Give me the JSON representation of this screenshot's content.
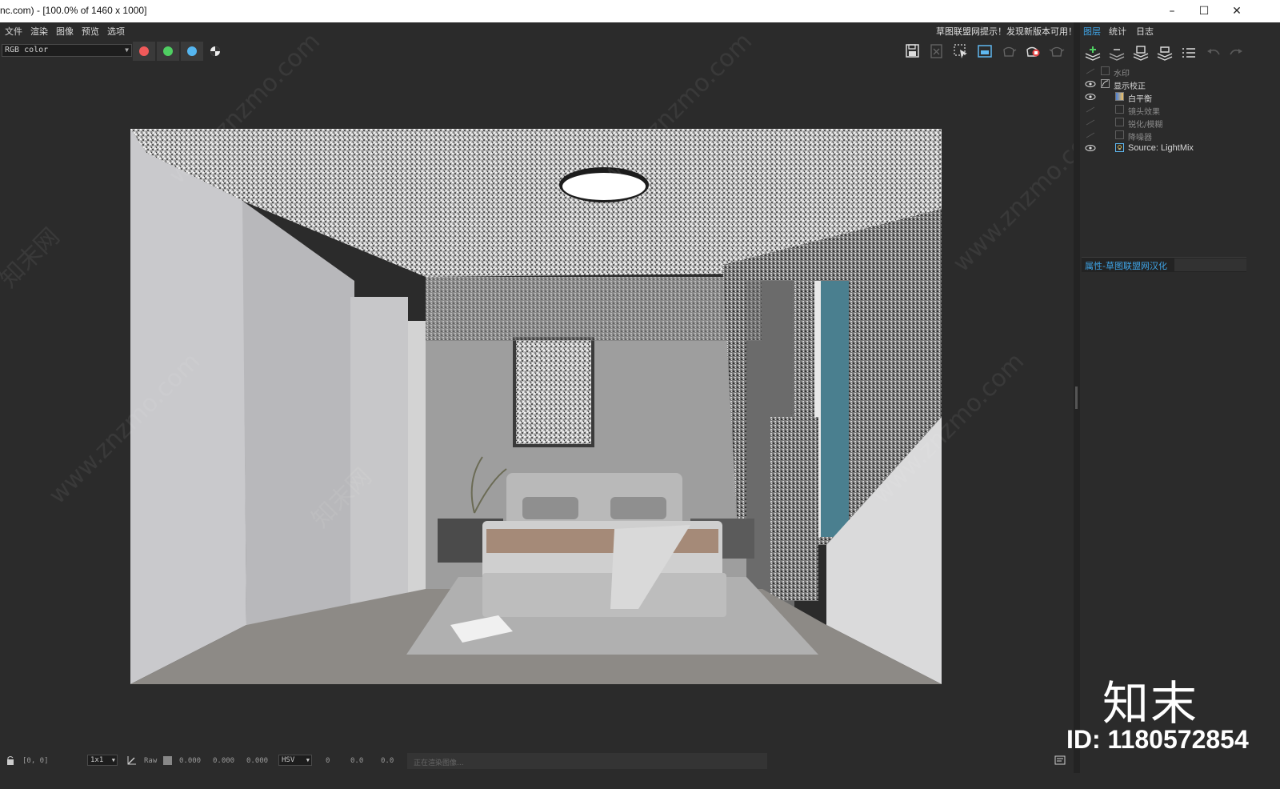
{
  "window": {
    "title": "nc.com) - [100.0% of 1460 x 1000]",
    "controls": {
      "minimize": "–",
      "maximize": "☐",
      "close": "✕"
    }
  },
  "menu": {
    "items": [
      "文件",
      "渲染",
      "图像",
      "预览",
      "选项"
    ],
    "notice": "草图联盟网提示！发现新版本可用！"
  },
  "toolbar": {
    "channel": "RGB color",
    "channel_buttons": [
      {
        "name": "red-channel",
        "color": "#f05a5a"
      },
      {
        "name": "green-channel",
        "color": "#4fcf62"
      },
      {
        "name": "blue-channel",
        "color": "#55b6f0"
      }
    ],
    "alpha_icon": "alpha-channel-icon",
    "right_icons": [
      "save-icon",
      "clear-icon",
      "region-render-icon",
      "follow-mouse-icon",
      "teapot-icon",
      "teapot-stop-icon",
      "teapot-outline-icon"
    ]
  },
  "watermark": {
    "text_cn": "知末网",
    "text_url": "www.znzmo.com"
  },
  "panel": {
    "tabs": [
      "图层",
      "统计",
      "日志"
    ],
    "active_tab": "图层",
    "tools": [
      "add-layer-icon",
      "remove-layer-icon",
      "save-layer-icon",
      "load-layer-icon",
      "list-icon",
      "undo-icon",
      "redo-icon"
    ],
    "layers": [
      {
        "label": "水印",
        "visible": false,
        "indent": 0
      },
      {
        "label": "显示校正",
        "visible": true,
        "indent": 0
      },
      {
        "label": "白平衡",
        "visible": true,
        "indent": 1
      },
      {
        "label": "镜头效果",
        "visible": false,
        "indent": 1
      },
      {
        "label": "锐化/模糊",
        "visible": false,
        "indent": 1
      },
      {
        "label": "降噪器",
        "visible": false,
        "indent": 1
      },
      {
        "label": "Source: LightMix",
        "visible": true,
        "indent": 1
      }
    ],
    "properties_label": "属性-草图联盟网汉化"
  },
  "logo": {
    "name": "知末",
    "id_text": "ID: 1180572854"
  },
  "status": {
    "coords": "[0, 0]",
    "zoom_select": "1x1",
    "raw_label": "Raw",
    "values": [
      "0.000",
      "0.000",
      "0.000"
    ],
    "color_mode": "HSV",
    "hsv_values": [
      "0",
      "0.0",
      "0.0"
    ],
    "progress_text": "正在渲染图像..."
  },
  "colors": {
    "accent": "#3fa5e8",
    "bg": "#2b2b2b"
  }
}
